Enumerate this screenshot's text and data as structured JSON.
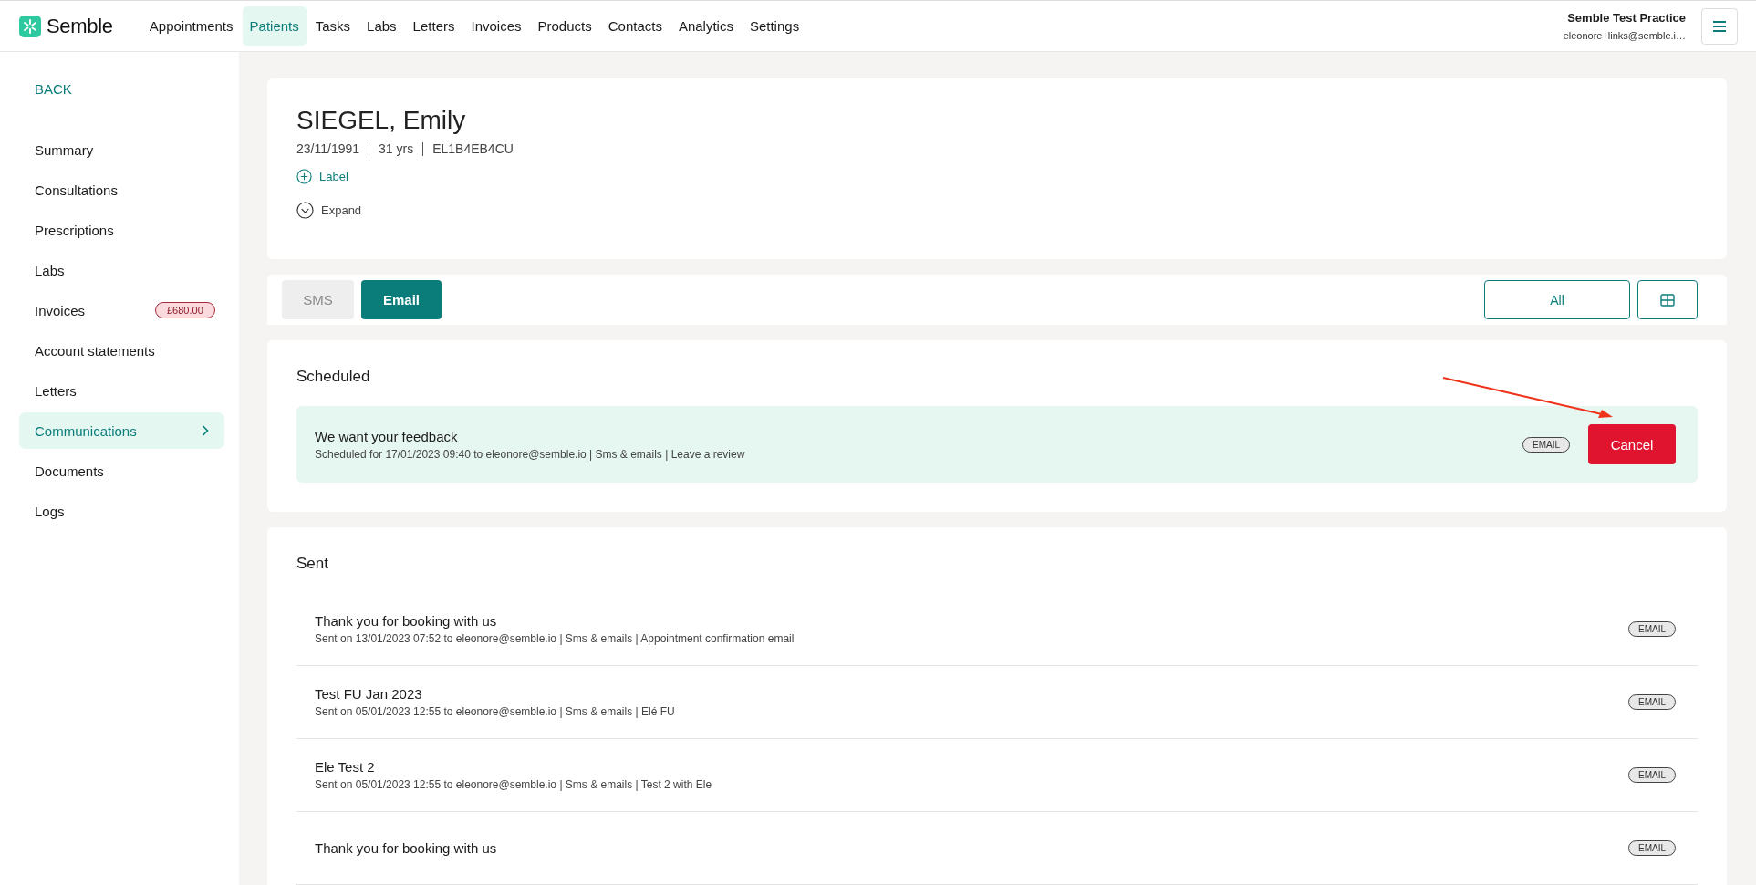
{
  "nav": {
    "logo": "Semble",
    "items": [
      {
        "label": "Appointments",
        "selected": false
      },
      {
        "label": "Patients",
        "selected": true
      },
      {
        "label": "Tasks",
        "selected": false
      },
      {
        "label": "Labs",
        "selected": false
      },
      {
        "label": "Letters",
        "selected": false
      },
      {
        "label": "Invoices",
        "selected": false
      },
      {
        "label": "Products",
        "selected": false
      },
      {
        "label": "Contacts",
        "selected": false
      },
      {
        "label": "Analytics",
        "selected": false
      },
      {
        "label": "Settings",
        "selected": false
      }
    ]
  },
  "account": {
    "practice": "Semble Test Practice",
    "email": "eleonore+links@semble.i…"
  },
  "sidebar": {
    "back": "BACK",
    "items": [
      {
        "label": "Summary",
        "selected": false
      },
      {
        "label": "Consultations",
        "selected": false
      },
      {
        "label": "Prescriptions",
        "selected": false
      },
      {
        "label": "Labs",
        "selected": false
      },
      {
        "label": "Invoices",
        "selected": false,
        "badge": "£680.00"
      },
      {
        "label": "Account statements",
        "selected": false
      },
      {
        "label": "Letters",
        "selected": false
      },
      {
        "label": "Communications",
        "selected": true
      },
      {
        "label": "Documents",
        "selected": false
      },
      {
        "label": "Logs",
        "selected": false
      }
    ]
  },
  "patient": {
    "name": "SIEGEL, Emily",
    "details": [
      "23/11/1991",
      "31 yrs",
      "EL1B4EB4CU"
    ],
    "label_action": "Label",
    "expand_action": "Expand"
  },
  "channel_tabs": [
    {
      "label": "SMS",
      "selected": false
    },
    {
      "label": "Email",
      "selected": true
    }
  ],
  "filter": {
    "value": "All"
  },
  "scheduled": {
    "heading": "Scheduled",
    "items": [
      {
        "title": "We want your feedback",
        "subtitle": "Scheduled for 17/01/2023 09:40 to eleonore@semble.io | Sms & emails | Leave a review",
        "tag": "EMAIL",
        "action": "Cancel"
      }
    ]
  },
  "sent": {
    "heading": "Sent",
    "items": [
      {
        "title": "Thank you for booking with us",
        "subtitle": "Sent on 13/01/2023 07:52 to eleonore@semble.io | Sms & emails | Appointment confirmation email",
        "tag": "EMAIL"
      },
      {
        "title": "Test FU Jan 2023",
        "subtitle": "Sent on 05/01/2023 12:55 to eleonore@semble.io | Sms & emails | Elé FU",
        "tag": "EMAIL"
      },
      {
        "title": "Ele Test 2",
        "subtitle": "Sent on 05/01/2023 12:55 to eleonore@semble.io | Sms & emails | Test 2 with Ele",
        "tag": "EMAIL"
      },
      {
        "title": "Thank you for booking with us",
        "tag": "EMAIL"
      }
    ]
  }
}
